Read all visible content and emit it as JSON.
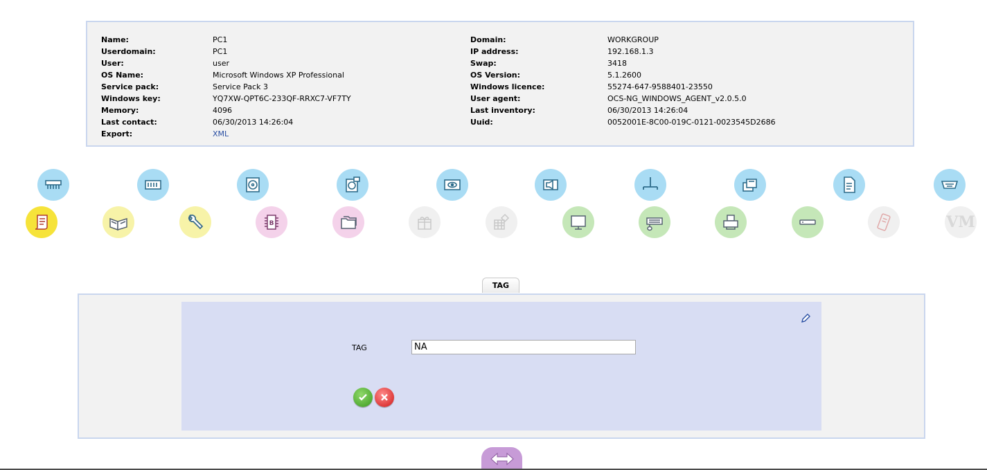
{
  "info": {
    "left": [
      {
        "label": "Name:",
        "value": "PC1"
      },
      {
        "label": "Userdomain:",
        "value": "PC1"
      },
      {
        "label": "User:",
        "value": "user"
      },
      {
        "label": "OS Name:",
        "value": "Microsoft Windows XP Professional"
      },
      {
        "label": "Service pack:",
        "value": "Service Pack 3"
      },
      {
        "label": "Windows key:",
        "value": "YQ7XW-QPT6C-233QF-RRXC7-VF7TY"
      },
      {
        "label": "Memory:",
        "value": "4096"
      },
      {
        "label": "Last contact:",
        "value": "06/30/2013 14:26:04"
      },
      {
        "label": "Export:",
        "value": "XML"
      }
    ],
    "right": [
      {
        "label": "Domain:",
        "value": "WORKGROUP"
      },
      {
        "label": "IP address:",
        "value": "192.168.1.3"
      },
      {
        "label": "Swap:",
        "value": "3418"
      },
      {
        "label": "OS Version:",
        "value": "5.1.2600"
      },
      {
        "label": "Windows licence:",
        "value": "55274-647-9588401-23550"
      },
      {
        "label": "User agent:",
        "value": "OCS-NG_WINDOWS_AGENT_v2.0.5.0"
      },
      {
        "label": "Last inventory:",
        "value": "06/30/2013 14:26:04"
      },
      {
        "label": "Uuid:",
        "value": "0052001E-8C00-019C-0121-0023545D2686"
      }
    ]
  },
  "icons_row1": [
    {
      "name": "memory-icon"
    },
    {
      "name": "ram-module-icon"
    },
    {
      "name": "hard-disk-icon"
    },
    {
      "name": "drives-icon"
    },
    {
      "name": "video-card-icon"
    },
    {
      "name": "sound-icon"
    },
    {
      "name": "network-icon"
    },
    {
      "name": "storage-icon"
    },
    {
      "name": "document-icon"
    },
    {
      "name": "serial-port-icon"
    }
  ],
  "icons_row2": [
    {
      "name": "bios-scroll-icon"
    },
    {
      "name": "book-icon"
    },
    {
      "name": "wrench-icon"
    },
    {
      "name": "chip-icon"
    },
    {
      "name": "folders-icon"
    },
    {
      "name": "gift-icon"
    },
    {
      "name": "registry-icon"
    },
    {
      "name": "monitor-icon"
    },
    {
      "name": "keyboard-mouse-icon"
    },
    {
      "name": "printer-icon"
    },
    {
      "name": "modem-icon"
    },
    {
      "name": "phone-icon"
    },
    {
      "name": "vm-icon",
      "text": "VM"
    }
  ],
  "tab": {
    "label": "TAG"
  },
  "tag_form": {
    "label": "TAG",
    "value": "NA"
  },
  "colors": {
    "panel_bg": "#f2f2f2",
    "panel_border": "#c9d6ee",
    "form_bg": "#d8ddf3",
    "link": "#2a4fa3",
    "collapse_button": "#c79bd7"
  }
}
